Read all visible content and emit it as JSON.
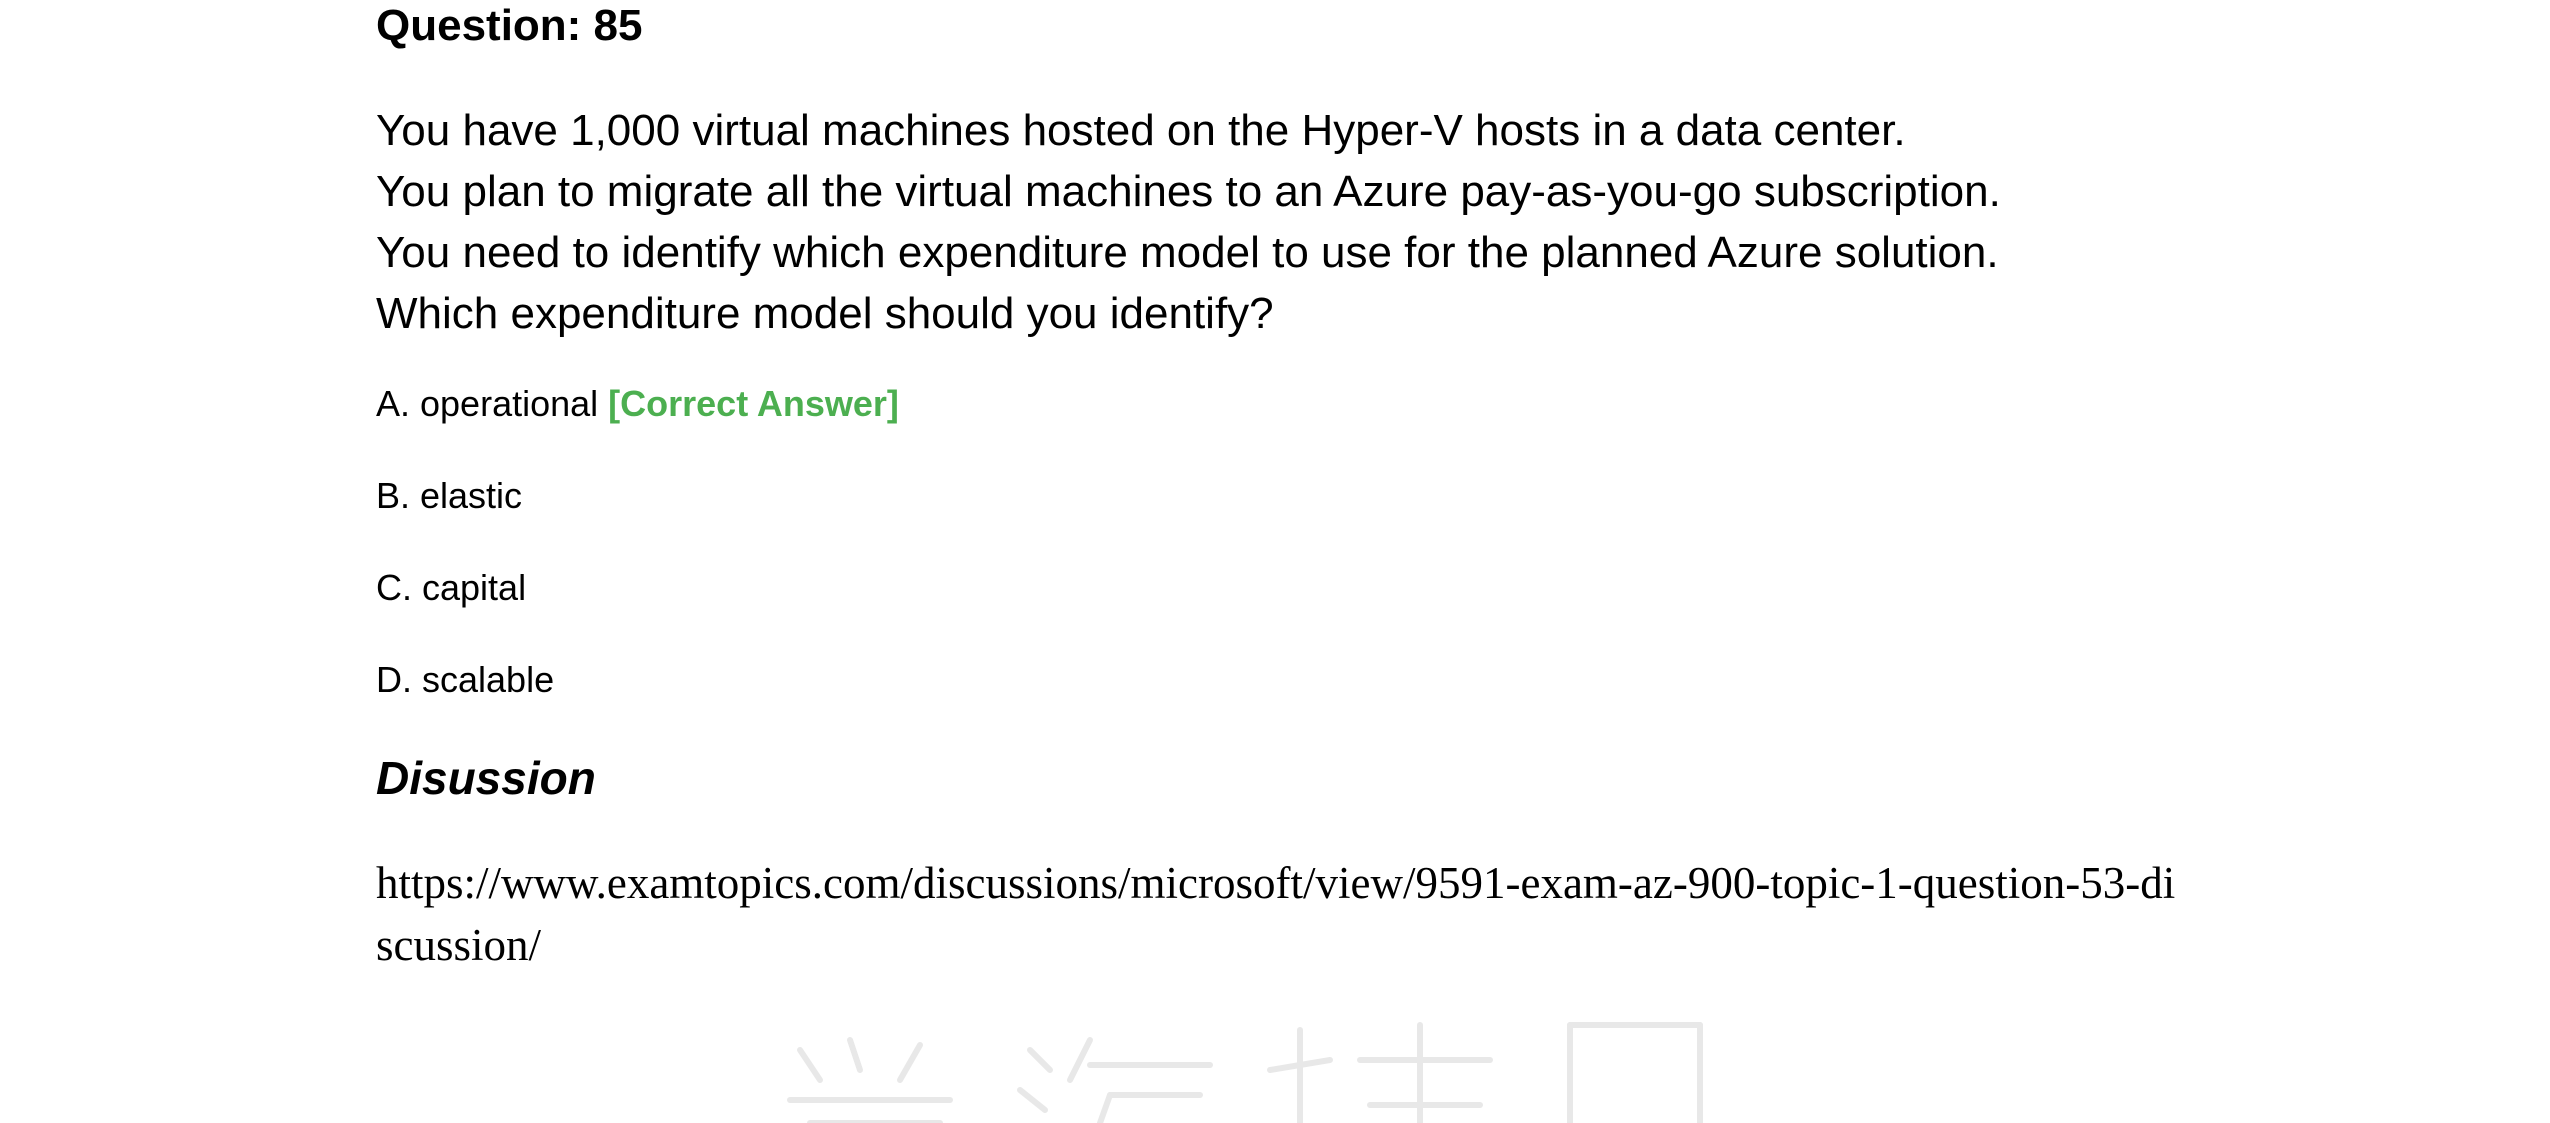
{
  "question": {
    "heading": "Question: 85",
    "stem_lines": [
      "You have 1,000 virtual machines hosted on the Hyper-V hosts in a data center.",
      "You plan to migrate all the virtual machines to an Azure pay-as-you-go subscription.",
      "You need to identify which expenditure model to use for the planned Azure solution.",
      "Which expenditure model should you identify?"
    ],
    "options": [
      {
        "text": "A. operational",
        "tag": "[Correct Answer]"
      },
      {
        "text": "B. elastic",
        "tag": ""
      },
      {
        "text": "C. capital",
        "tag": ""
      },
      {
        "text": "D. scalable",
        "tag": ""
      }
    ]
  },
  "discussion": {
    "heading": "Disussion",
    "link": "https://www.examtopics.com/discussions/microsoft/view/9591-exam-az-900-topic-1-question-53-discussion/"
  },
  "colors": {
    "correct_tag": "#4caf50",
    "watermark": "#e8e8e8"
  }
}
